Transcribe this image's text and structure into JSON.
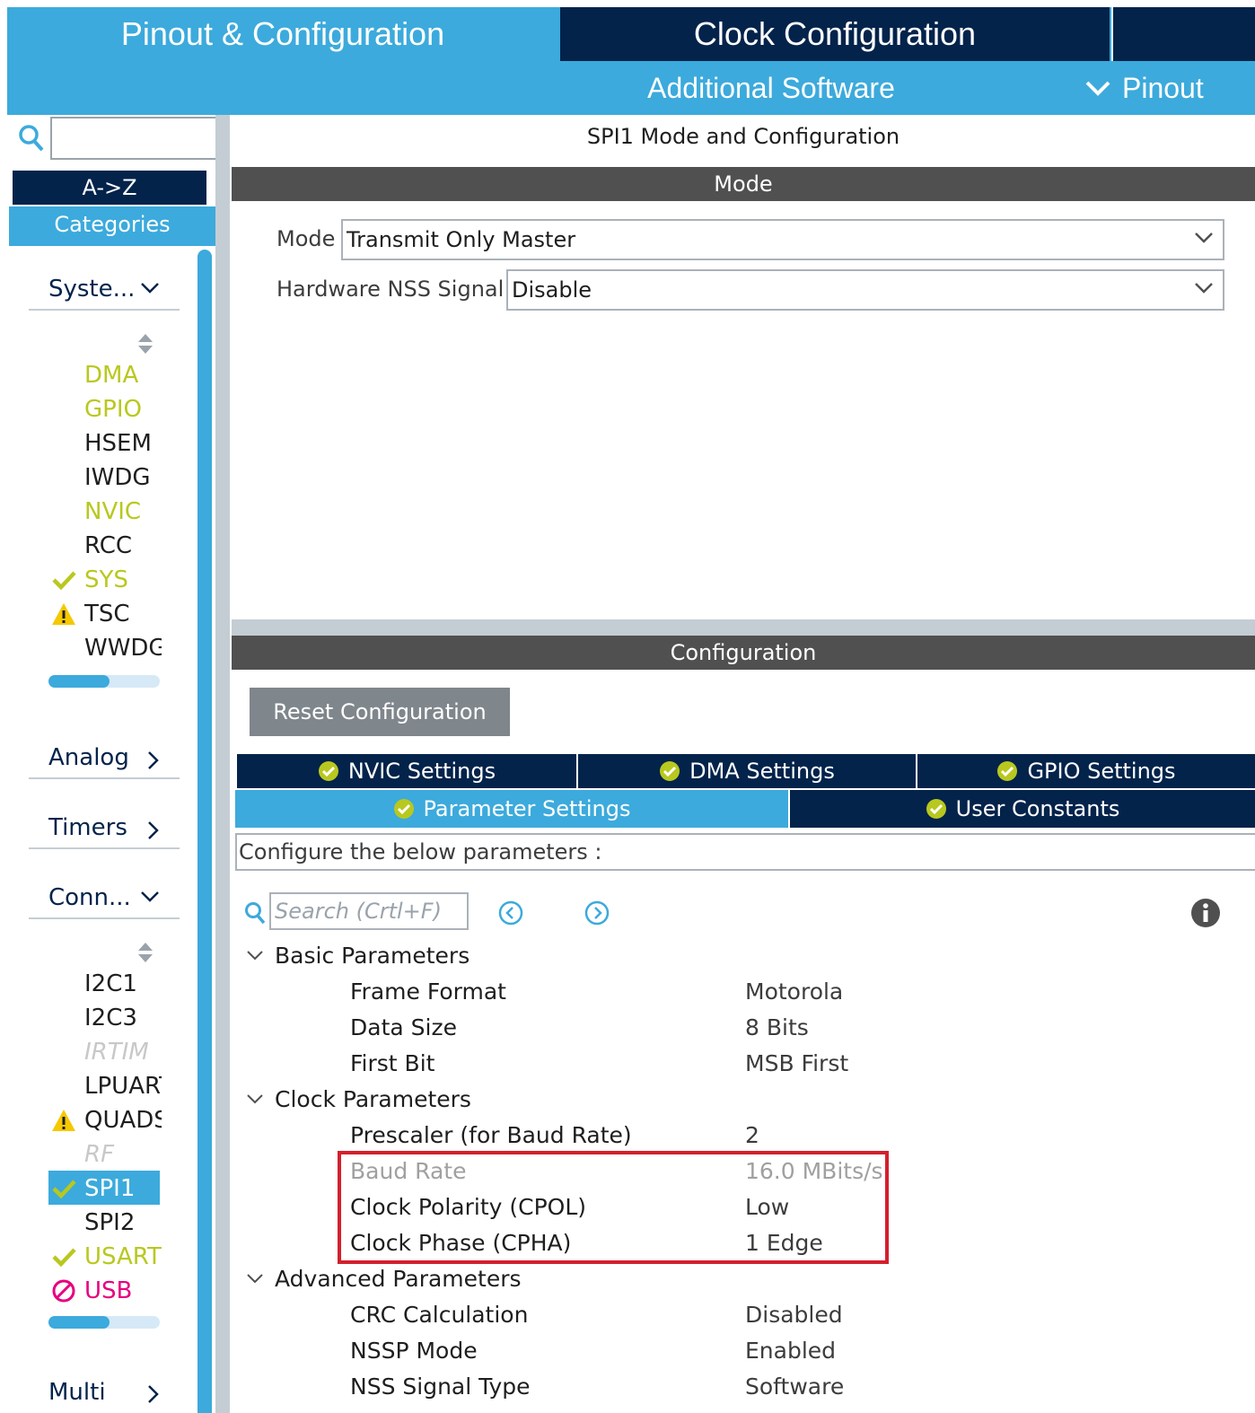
{
  "top_tabs": {
    "pinout_config": "Pinout & Configuration",
    "clock_config": "Clock Configuration"
  },
  "sub_tabs": {
    "additional_software": "Additional Software",
    "pinout": "Pinout"
  },
  "sidebar": {
    "search_value": "",
    "az_label": "A->Z",
    "categories_label": "Categories",
    "groups": {
      "system": "Syste...",
      "analog": "Analog",
      "timers": "Timers",
      "connectivity": "Conn...",
      "multimedia": "Multi"
    },
    "system_items": [
      {
        "label": "DMA",
        "status": "configured-partial"
      },
      {
        "label": "GPIO",
        "status": "configured-partial"
      },
      {
        "label": "HSEM",
        "status": "none"
      },
      {
        "label": "IWDG",
        "status": "none"
      },
      {
        "label": "NVIC",
        "status": "configured-partial"
      },
      {
        "label": "RCC",
        "status": "none"
      },
      {
        "label": "SYS",
        "status": "ok"
      },
      {
        "label": "TSC",
        "status": "warning"
      },
      {
        "label": "WWDG",
        "status": "none"
      }
    ],
    "connectivity_items": [
      {
        "label": "I2C1",
        "status": "none"
      },
      {
        "label": "I2C3",
        "status": "none"
      },
      {
        "label": "IRTIM",
        "status": "unavailable"
      },
      {
        "label": "LPUART",
        "status": "none"
      },
      {
        "label": "QUADSPI",
        "status": "warning"
      },
      {
        "label": "RF",
        "status": "unavailable"
      },
      {
        "label": "SPI1",
        "status": "ok-selected"
      },
      {
        "label": "SPI2",
        "status": "none"
      },
      {
        "label": "USART",
        "status": "ok"
      },
      {
        "label": "USB",
        "status": "conflict"
      }
    ],
    "system_scroll_fraction": 0.55,
    "connectivity_scroll_fraction": 0.55
  },
  "main": {
    "title": "SPI1 Mode and Configuration",
    "mode_section": "Mode",
    "mode_label": "Mode",
    "mode_value": "Transmit Only Master",
    "nss_label": "Hardware NSS Signal",
    "nss_value": "Disable",
    "config_section": "Configuration",
    "reset_button": "Reset Configuration",
    "tabs": {
      "nvic": "NVIC Settings",
      "dma": "DMA Settings",
      "gpio": "GPIO Settings",
      "parameter": "Parameter Settings",
      "user_constants": "User Constants"
    },
    "active_tab": "Parameter Settings",
    "config_note": "Configure the below parameters :",
    "search_placeholder": "Search (Crtl+F)",
    "groups": [
      {
        "label": "Basic Parameters",
        "params": [
          {
            "name": "Frame Format",
            "value": "Motorola"
          },
          {
            "name": "Data Size",
            "value": "8 Bits"
          },
          {
            "name": "First Bit",
            "value": "MSB First"
          }
        ]
      },
      {
        "label": "Clock Parameters",
        "params": [
          {
            "name": "Prescaler (for Baud Rate)",
            "value": "2"
          },
          {
            "name": "Baud Rate",
            "value": "16.0 MBits/s"
          },
          {
            "name": "Clock Polarity (CPOL)",
            "value": "Low"
          },
          {
            "name": "Clock Phase (CPHA)",
            "value": "1 Edge"
          }
        ]
      },
      {
        "label": "Advanced Parameters",
        "params": [
          {
            "name": "CRC Calculation",
            "value": "Disabled"
          },
          {
            "name": "NSSP Mode",
            "value": "Enabled"
          },
          {
            "name": "NSS Signal Type",
            "value": "Software"
          }
        ]
      }
    ]
  },
  "colors": {
    "accent_blue": "#3caadc",
    "dark_navy": "#03234b",
    "section_grey": "#505050",
    "ok_green": "#b9c81e",
    "warning_yellow": "#f5c800",
    "conflict_pink": "#e6007e",
    "highlight_red": "#d3202d"
  },
  "icons": {
    "search": "magnifier-icon",
    "check": "check-icon",
    "warning": "warning-triangle-icon",
    "conflict": "no-entry-icon",
    "chevron": "chevron-down-icon",
    "info": "info-icon"
  }
}
